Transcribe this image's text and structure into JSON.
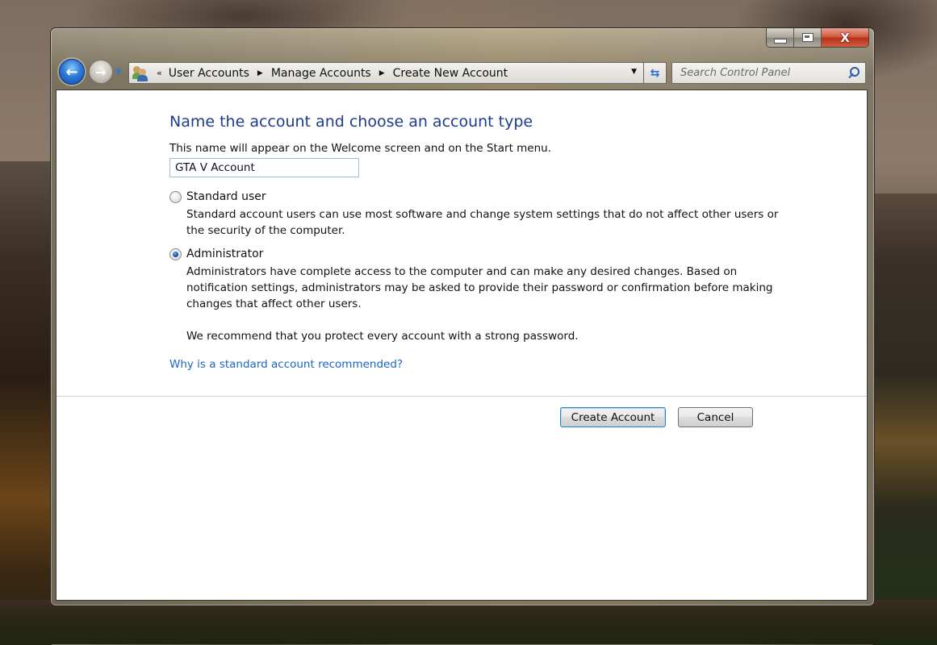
{
  "window": {
    "caption_buttons": {
      "minimize": "minimize-icon",
      "maximize": "maximize-icon",
      "close": "close-icon"
    }
  },
  "navigation": {
    "back_icon": "back-arrow-icon",
    "forward_icon": "forward-arrow-icon",
    "recent_pages_icon": "chevron-down-icon"
  },
  "address_bar": {
    "icon": "user-accounts-icon",
    "overflow_glyph": "«",
    "breadcrumbs": [
      "User Accounts",
      "Manage Accounts",
      "Create New Account"
    ],
    "separator_glyph": "▶",
    "dropdown_glyph": "▼",
    "refresh_glyph": "⇆"
  },
  "search": {
    "placeholder": "Search Control Panel",
    "value": ""
  },
  "page": {
    "heading": "Name the account and choose an account type",
    "name_prompt": "This name will appear on the Welcome screen and on the Start menu.",
    "account_name_value": "GTA V Account",
    "options": [
      {
        "label": "Standard user",
        "checked": false,
        "description": "Standard account users can use most software and change system settings that do not affect other users or the security of the computer."
      },
      {
        "label": "Administrator",
        "checked": true,
        "description": "Administrators have complete access to the computer and can make any desired changes. Based on notification settings, administrators may be asked to provide their password or confirmation before making changes that affect other users.",
        "note": "We recommend that you protect every account with a strong password."
      }
    ],
    "help_link": "Why is a standard account recommended?",
    "buttons": {
      "create": "Create Account",
      "cancel": "Cancel"
    }
  }
}
